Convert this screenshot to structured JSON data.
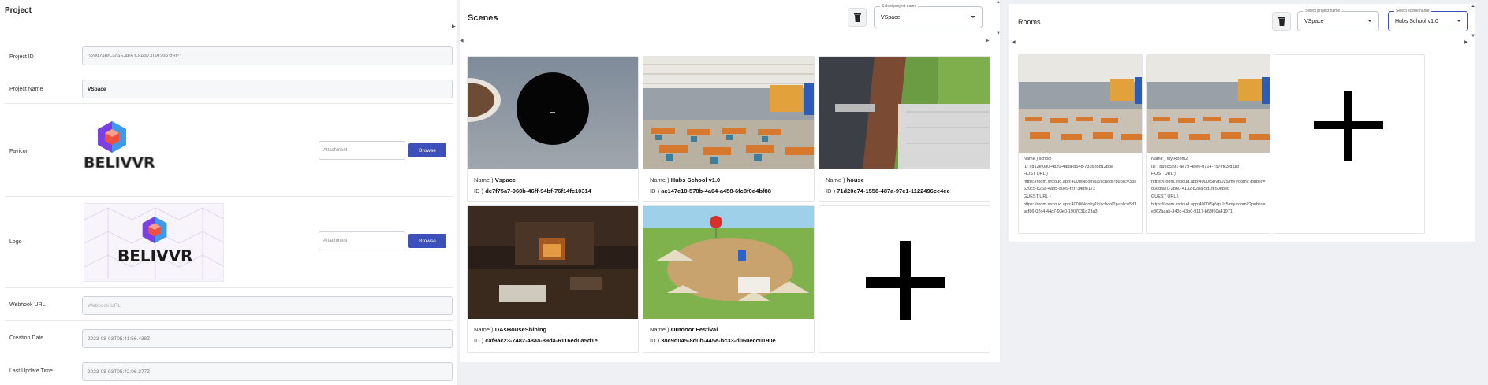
{
  "project": {
    "title": "Project",
    "fields": {
      "project_id_label": "Project ID",
      "project_id_value": "0e997abb-aca5-4b51-8e97-0a929e3f6fc1",
      "project_name_label": "Project Name",
      "project_name_value": "VSpace",
      "favicon_label": "Favicon",
      "logo_label": "Logo",
      "webhook_label": "Webhook URL",
      "webhook_placeholder": "Webhook URL",
      "creation_label": "Creation Date",
      "creation_value": "2023-08-03T05:41:56.438Z",
      "update_label": "Last Update Time",
      "update_value": "2023-08-03T05:42:06.377Z"
    },
    "attachment_placeholder": "Attachment",
    "browse_label": "Browse",
    "brand_text": "BELIVVR"
  },
  "scenes": {
    "title": "Scenes",
    "project_select_caption": "Select project name",
    "project_select_value": "VSpace",
    "name_prefix": "Name )",
    "id_prefix": "ID )",
    "items": [
      {
        "name": "Vspace",
        "id": "dc7f75a7-960b-46ff-94bf-76f14fc10314"
      },
      {
        "name": "Hubs School v1.0",
        "id": "ac147e10-578b-4a04-a458-6fc8f0d4bf88"
      },
      {
        "name": "house",
        "id": "71d20e74-1558-487a-97c1-1122496ce4ee"
      },
      {
        "name": "DAsHouseShining",
        "id": "caf9ac23-7482-48aa-89da-6116ed0a5d1e"
      },
      {
        "name": "Outdoor Festival",
        "id": "38c9d045-8d0b-445e-bc33-d060ecc0190e"
      }
    ]
  },
  "rooms": {
    "title": "Rooms",
    "project_select_caption": "Select project name",
    "project_select_value": "VSpace",
    "scene_select_caption": "Select scene name",
    "scene_select_value": "Hubs School v1.0",
    "name_prefix": "Name )",
    "id_prefix": "ID )",
    "host_prefix": "HOST URL )",
    "guest_prefix": "GUEST URL )",
    "items": [
      {
        "name": "school",
        "id": "812ef080-4820-4aba-b54b-733635d12b3e",
        "host_url": "https://room.xrcloud.app:4000/Ndohy1k/school?public=33a620c5-826a-4a95-a0e9-f2f734bfe173",
        "guest_url": "https://room.xrcloud.app:4000/Ndohy1k/school?public=5d1acf86-02c4-44c7-93e0-1907031d23a3"
      },
      {
        "name": "My Room2",
        "id": "b93cca91-ae79-4be0-b714-757efc3fd11b",
        "host_url": "https://room.xrcloud.app:4000/SpVpUz5/my-room2?public=866dfa70-2b60-4132-b28a-5d1fe50ebec",
        "guest_url": "https://room.xrcloud.app:4000/SpVpUz5/my-room2?public=e862baab-343c-43b0-9117-b63f60a41971"
      }
    ]
  },
  "colors": {
    "primary_button": "#3d4fb8",
    "active_select_border": "#3d4fb8",
    "page_background": "#eef0f4"
  }
}
